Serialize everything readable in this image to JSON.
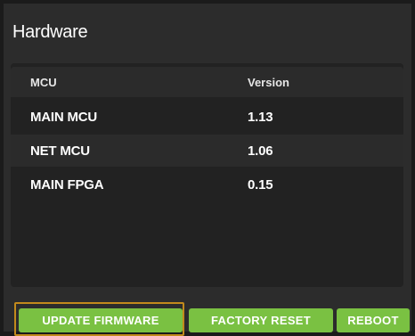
{
  "panel": {
    "title": "Hardware"
  },
  "table": {
    "columns": [
      "MCU",
      "Version"
    ],
    "rows": [
      {
        "mcu": "MAIN MCU",
        "version": "1.13"
      },
      {
        "mcu": "NET MCU",
        "version": "1.06"
      },
      {
        "mcu": "MAIN FPGA",
        "version": "0.15"
      }
    ]
  },
  "actions": {
    "update_firmware": "UPDATE FIRMWARE",
    "factory_reset": "FACTORY RESET",
    "reboot": "REBOOT"
  },
  "colors": {
    "button_green": "#7ac142",
    "focus_outline": "#c28a1c",
    "panel_bg": "#2c2c2c",
    "table_bg": "#222222"
  }
}
